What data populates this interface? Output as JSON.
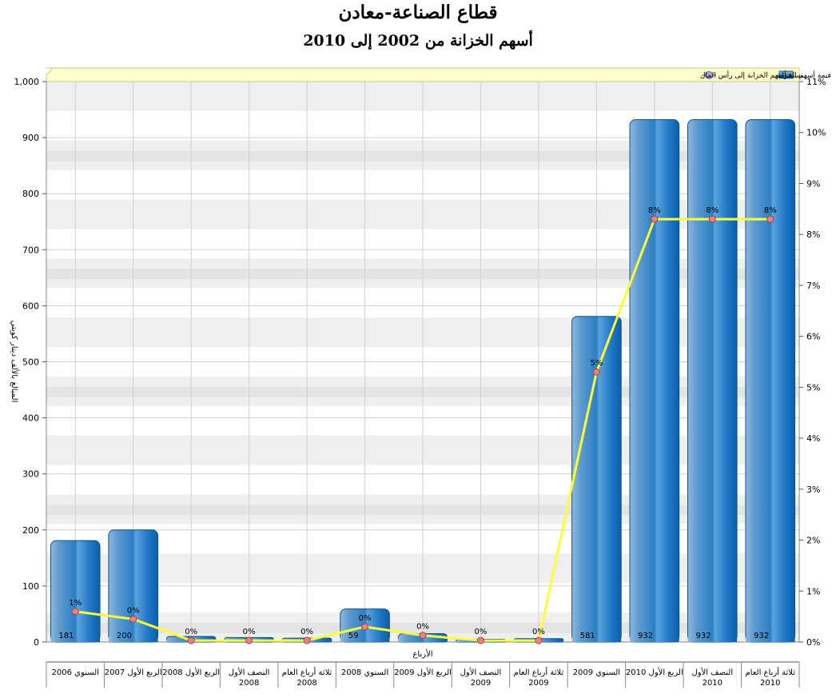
{
  "chart_data": {
    "type": "bar",
    "title": "قطاع الصناعة-معادن",
    "subtitle": "أسهم الخزانة من 2002 إلى 2010",
    "xlabel": "الأرباع",
    "ylabel": "المبالغ بالألف دينار كويتي",
    "ylim": [
      0,
      1000
    ],
    "y2lim": [
      0,
      11
    ],
    "y_ticks": [
      "0",
      "100",
      "200",
      "300",
      "400",
      "500",
      "600",
      "700",
      "800",
      "900",
      "1,000"
    ],
    "y2_ticks": [
      "0%",
      "1%",
      "2%",
      "3%",
      "4%",
      "5%",
      "6%",
      "7%",
      "8%",
      "9%",
      "10%",
      "11%"
    ],
    "grid": true,
    "legend_position": "top",
    "categories": [
      [
        "السنوي 2006"
      ],
      [
        "الربع الأول 2007"
      ],
      [
        "الربع الأول 2008"
      ],
      [
        "النصف الأول",
        "2008"
      ],
      [
        "ثلاثة أرباع العام",
        "2008"
      ],
      [
        "السنوي 2008"
      ],
      [
        "الربع الأول 2009"
      ],
      [
        "النصف الأول",
        "2009"
      ],
      [
        "ثلاثة أرباع العام",
        "2009"
      ],
      [
        "السنوي 2009"
      ],
      [
        "الربع الأول 2010"
      ],
      [
        "النصف الأول",
        "2010"
      ],
      [
        "ثلاثة أرباع العام",
        "2010"
      ]
    ],
    "series": [
      {
        "name": "قيمة أسهم الخزانة",
        "kind": "bar",
        "axis": "left",
        "color": "#2b7fc4",
        "values": [
          181,
          200,
          10,
          8,
          7,
          59,
          15,
          5,
          6,
          581,
          932,
          932,
          932
        ],
        "labels": [
          "181",
          "200",
          "",
          "",
          "",
          "59",
          "",
          "",
          "",
          "581",
          "932",
          "932",
          "932"
        ]
      },
      {
        "name": "نسبة أسهم الخزانة إلى رأس المال",
        "kind": "line",
        "axis": "right",
        "color": "#ffff33",
        "marker_color": "#f08080",
        "values": [
          0.6,
          0.45,
          0.03,
          0.03,
          0.03,
          0.3,
          0.13,
          0.03,
          0.03,
          5.3,
          8.3,
          8.3,
          8.3
        ],
        "labels": [
          "1%",
          "0%",
          "0%",
          "0%",
          "0%",
          "0%",
          "0%",
          "0%",
          "0%",
          "5%",
          "8%",
          "8%",
          "8%"
        ]
      }
    ]
  }
}
